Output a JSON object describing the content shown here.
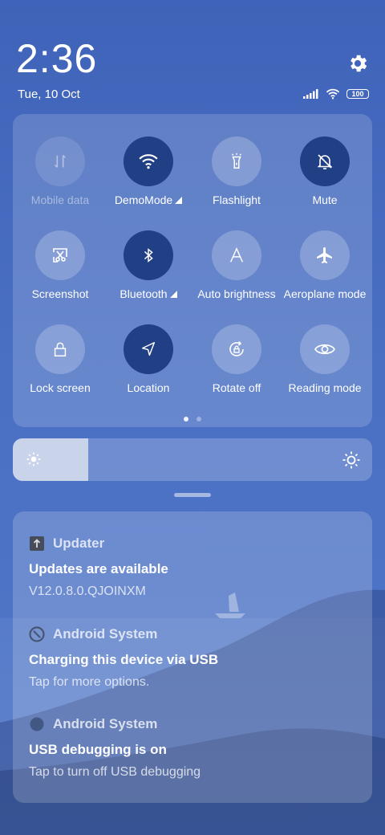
{
  "clock": {
    "time": "2:36",
    "date": "Tue, 10 Oct"
  },
  "status_bar": {
    "battery": "100",
    "icons": [
      "signal-icon",
      "wifi-icon",
      "battery-icon"
    ]
  },
  "quick_settings": {
    "tiles": [
      {
        "label": "Mobile data",
        "icon": "mobile-data-icon",
        "state": "disabled"
      },
      {
        "label": "DemoMode",
        "icon": "wifi-icon",
        "state": "on"
      },
      {
        "label": "Flashlight",
        "icon": "flashlight-icon",
        "state": "off"
      },
      {
        "label": "Mute",
        "icon": "bell-off-icon",
        "state": "on"
      },
      {
        "label": "Screenshot",
        "icon": "screenshot-icon",
        "state": "off"
      },
      {
        "label": "Bluetooth",
        "icon": "bluetooth-icon",
        "state": "on"
      },
      {
        "label": "Auto brightness",
        "icon": "auto-brightness-icon",
        "state": "off"
      },
      {
        "label": "Aeroplane mode",
        "icon": "airplane-icon",
        "state": "off"
      },
      {
        "label": "Lock screen",
        "icon": "lock-icon",
        "state": "off"
      },
      {
        "label": "Location",
        "icon": "location-icon",
        "state": "on"
      },
      {
        "label": "Rotate off",
        "icon": "rotate-lock-icon",
        "state": "off"
      },
      {
        "label": "Reading mode",
        "icon": "eye-icon",
        "state": "off"
      }
    ],
    "page_indicator": {
      "current": 1,
      "total": 2
    }
  },
  "brightness": {
    "level_fraction": 0.21
  },
  "notifications": [
    {
      "app": "Updater",
      "title": "Updates are available",
      "text": "V12.0.8.0.QJOINXM",
      "icon": "updater-icon"
    },
    {
      "app": "Android System",
      "title": "Charging this device via USB",
      "text": "Tap for more options.",
      "icon": "android-system-icon"
    },
    {
      "app": "Android System",
      "title": "USB debugging is on",
      "text": "Tap to turn off USB debugging",
      "icon": "android-system-icon"
    }
  ],
  "colors": {
    "background": "#3f63b8",
    "active_tile": "#213f85",
    "brightness_fill": "#c9d4ea"
  }
}
